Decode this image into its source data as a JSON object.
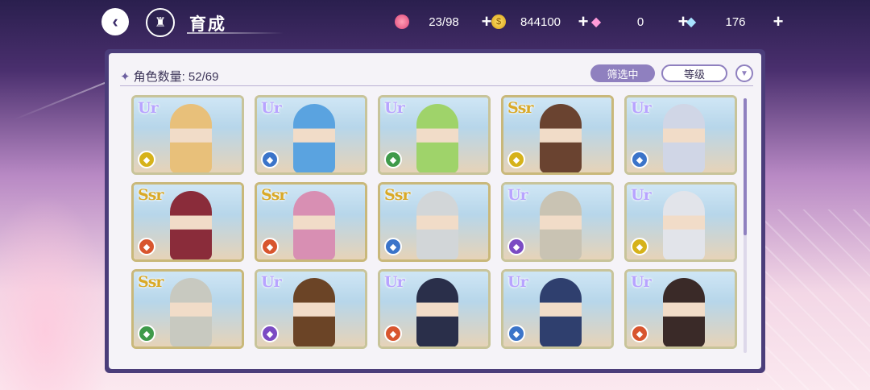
{
  "header": {
    "title": "育成",
    "back_icon": "back-arrow-icon",
    "home_icon": "castle-icon"
  },
  "resources": [
    {
      "name": "candy",
      "icon": "candy-icon",
      "value": "23/98"
    },
    {
      "name": "coin",
      "icon": "coin-icon",
      "value": "844100"
    },
    {
      "name": "pink-gem",
      "icon": "pink-diamond-icon",
      "value": "0"
    },
    {
      "name": "blue-gem",
      "icon": "blue-diamond-icon",
      "value": "176"
    }
  ],
  "panel": {
    "count_label": "角色数量: 52/69",
    "filter_button": "筛选中",
    "sort_button": "等级"
  },
  "colors": {
    "accent": "#8f80bf",
    "role_red": "#d8552e",
    "role_blue": "#3b74c9",
    "role_green": "#3f9a4a",
    "role_yellow": "#d6b21a",
    "role_purple": "#7b4bc3"
  },
  "cards": [
    {
      "rarity": "UR",
      "role_color": "#d6b21a",
      "figure_color": "#e8c07a"
    },
    {
      "rarity": "UR",
      "role_color": "#3b74c9",
      "figure_color": "#5aa3e0"
    },
    {
      "rarity": "UR",
      "role_color": "#3f9a4a",
      "figure_color": "#9fd36a"
    },
    {
      "rarity": "SSR",
      "role_color": "#d6b21a",
      "figure_color": "#6a4330"
    },
    {
      "rarity": "UR",
      "role_color": "#3b74c9",
      "figure_color": "#d0d6e6"
    },
    {
      "rarity": "SSR",
      "role_color": "#d8552e",
      "figure_color": "#8a2c3a"
    },
    {
      "rarity": "SSR",
      "role_color": "#d8552e",
      "figure_color": "#d88fb3"
    },
    {
      "rarity": "SSR",
      "role_color": "#3b74c9",
      "figure_color": "#d2d6d8"
    },
    {
      "rarity": "UR",
      "role_color": "#7b4bc3",
      "figure_color": "#c9c3b3"
    },
    {
      "rarity": "UR",
      "role_color": "#d6b21a",
      "figure_color": "#e2e4ea"
    },
    {
      "rarity": "SSR",
      "role_color": "#3f9a4a",
      "figure_color": "#c8c9c0"
    },
    {
      "rarity": "UR",
      "role_color": "#7b4bc3",
      "figure_color": "#6b4426"
    },
    {
      "rarity": "UR",
      "role_color": "#d8552e",
      "figure_color": "#2a2f4a"
    },
    {
      "rarity": "UR",
      "role_color": "#3b74c9",
      "figure_color": "#2f3f6e"
    },
    {
      "rarity": "UR",
      "role_color": "#d8552e",
      "figure_color": "#3a2a28"
    }
  ]
}
